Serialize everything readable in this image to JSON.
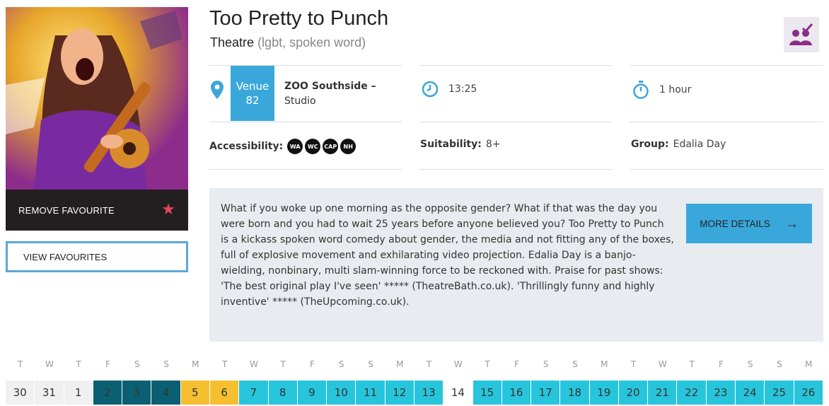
{
  "show": {
    "title": "Too Pretty to Punch",
    "genre": "Theatre",
    "tags": "(lgbt, spoken word)"
  },
  "favourites": {
    "remove_label": "REMOVE FAVOURITE",
    "view_label": "VIEW FAVOURITES"
  },
  "venue": {
    "label": "Venue",
    "number": "82",
    "name": "ZOO Southside",
    "room": "Studio",
    "separator": " –"
  },
  "time": "13:25",
  "duration": "1 hour",
  "accessibility": {
    "label": "Accessibility:",
    "icons": [
      {
        "name": "wheelchair-access-icon",
        "text": "WA"
      },
      {
        "name": "wheelchair-toilet-icon",
        "text": "WC"
      },
      {
        "name": "captioned-icon",
        "text": "CAP"
      },
      {
        "name": "hearing-loop-icon",
        "text": "NH"
      }
    ]
  },
  "suitability": {
    "label": "Suitability:",
    "value": "8+"
  },
  "group": {
    "label": "Group:",
    "value": "Edalia Day"
  },
  "description": "What if you woke up one morning as the opposite gender? What if that was the day you were born and you had to wait 25 years before anyone believed you? Too Pretty to Punch is a kickass spoken word comedy about gender, the media and not fitting any of the boxes, full of explosive movement and exhilarating video projection. Edalia Day is a banjo-wielding, nonbinary, multi slam-winning force to be reckoned with. Praise for past shows: 'The best original play I've seen' ***** (TheatreBath.co.uk). 'Thrillingly funny and highly inventive' ***** (TheUpcoming.co.uk).",
  "more_details_label": "MORE DETAILS",
  "colors": {
    "accent": "#3aa7db",
    "dark_day": "#0b5f73",
    "yellow_day": "#f5bf30",
    "teal_day": "#27c5dc",
    "favourite_star": "#e8455f"
  },
  "calendar": {
    "weekdays": [
      "T",
      "W",
      "T",
      "F",
      "S",
      "S",
      "M",
      "T",
      "W",
      "T",
      "F",
      "S",
      "S",
      "M",
      "T",
      "W",
      "T",
      "F",
      "S",
      "S",
      "M",
      "T",
      "W",
      "T",
      "F",
      "S",
      "S",
      "M"
    ],
    "dates": [
      {
        "day": "30",
        "style": "gray"
      },
      {
        "day": "31",
        "style": "gray"
      },
      {
        "day": "1",
        "style": "gray"
      },
      {
        "day": "2",
        "style": "dark"
      },
      {
        "day": "3",
        "style": "dark"
      },
      {
        "day": "4",
        "style": "dark"
      },
      {
        "day": "5",
        "style": "yellow"
      },
      {
        "day": "6",
        "style": "yellow"
      },
      {
        "day": "7",
        "style": "teal"
      },
      {
        "day": "8",
        "style": "teal"
      },
      {
        "day": "9",
        "style": "teal"
      },
      {
        "day": "10",
        "style": "teal"
      },
      {
        "day": "11",
        "style": "teal"
      },
      {
        "day": "12",
        "style": "teal"
      },
      {
        "day": "13",
        "style": "teal"
      },
      {
        "day": "14",
        "style": "white"
      },
      {
        "day": "15",
        "style": "teal"
      },
      {
        "day": "16",
        "style": "teal"
      },
      {
        "day": "17",
        "style": "teal"
      },
      {
        "day": "18",
        "style": "teal"
      },
      {
        "day": "19",
        "style": "teal"
      },
      {
        "day": "20",
        "style": "teal"
      },
      {
        "day": "21",
        "style": "teal"
      },
      {
        "day": "22",
        "style": "teal"
      },
      {
        "day": "23",
        "style": "teal"
      },
      {
        "day": "24",
        "style": "teal"
      },
      {
        "day": "25",
        "style": "teal"
      },
      {
        "day": "26",
        "style": "teal"
      }
    ]
  }
}
